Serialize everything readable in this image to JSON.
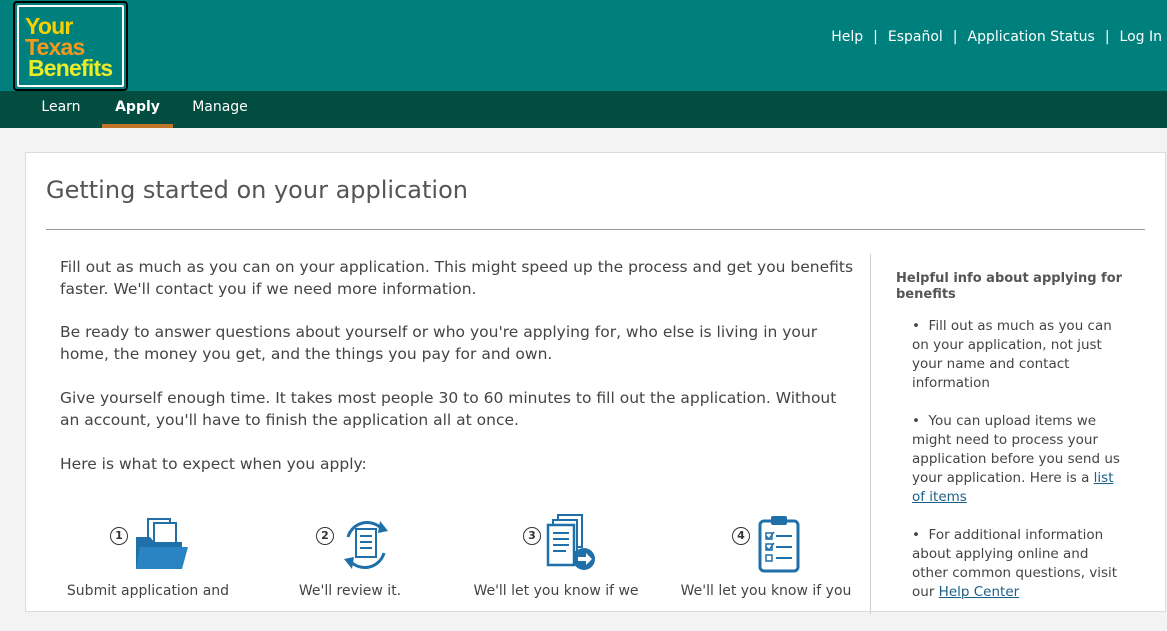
{
  "header": {
    "logo": {
      "line1": "Your",
      "line2": "Texas",
      "line3": "Benefits"
    },
    "links": [
      "Help",
      "Español",
      "Application Status",
      "Log In"
    ]
  },
  "nav": {
    "tabs": [
      {
        "label": "Learn",
        "active": false
      },
      {
        "label": "Apply",
        "active": true
      },
      {
        "label": "Manage",
        "active": false
      }
    ]
  },
  "main": {
    "title": "Getting started on your application",
    "paragraphs": [
      "Fill out as much as you can on your application. This might speed up the process and get you benefits faster. We'll contact you if we need more information.",
      "Be ready to answer questions about yourself or who you're applying for, who else is living in your home, the money you get, and the things you pay for and own.",
      "Give yourself enough time. It takes most people 30 to 60 minutes to fill out the application. Without an account, you'll have to finish the application all at once.",
      "Here is what to expect when you apply:"
    ],
    "steps": [
      {
        "number": "1",
        "label": "Submit application and",
        "icon": "folder-documents-icon"
      },
      {
        "number": "2",
        "label": "We'll review it.",
        "icon": "review-cycle-icon"
      },
      {
        "number": "3",
        "label": "We'll let you know if we",
        "icon": "documents-forward-icon"
      },
      {
        "number": "4",
        "label": "We'll let you know if you",
        "icon": "clipboard-checklist-icon"
      }
    ]
  },
  "sidebar": {
    "title": "Helpful info about applying for benefits",
    "items": [
      {
        "text": "Fill out as much as you can on your application, not just your name and contact information"
      },
      {
        "text": "You can upload items we might need to process your application before you send us your application. Here is a ",
        "link": "list of items"
      },
      {
        "text": "For additional information about applying online and other common questions, visit our ",
        "link": "Help Center"
      }
    ]
  },
  "colors": {
    "header_bg": "#00807d",
    "nav_bg": "#024d40",
    "active_tab_underline": "#c1752b",
    "icon_blue": "#1f6fa8"
  }
}
